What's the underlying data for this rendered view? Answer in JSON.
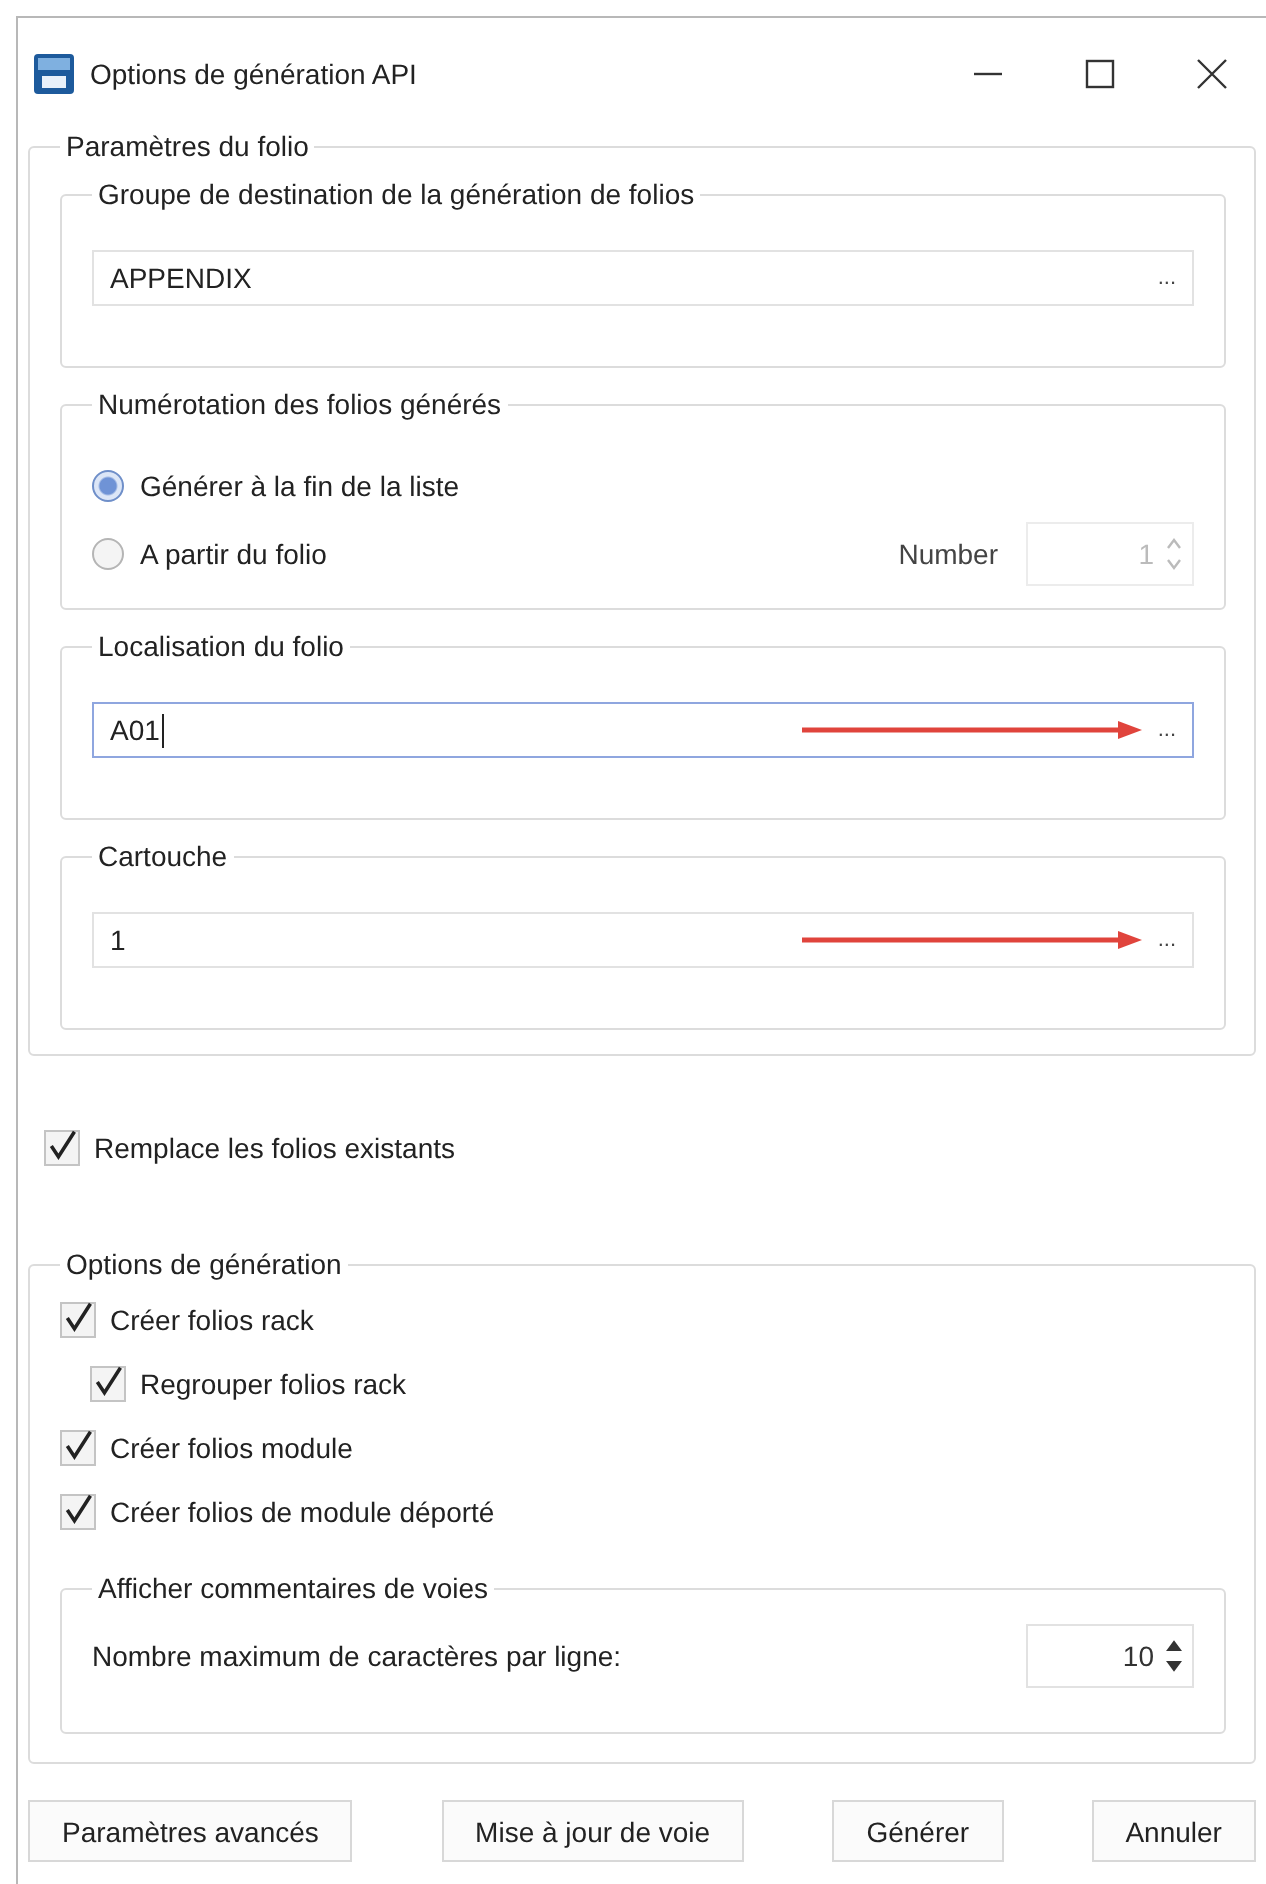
{
  "window": {
    "title": "Options de génération API"
  },
  "folio_parameters": {
    "title": "Paramètres du folio",
    "destination_group": {
      "title": "Groupe de destination de la génération de folios",
      "value": "APPENDIX",
      "browse": "...",
      "annotated": false,
      "focused": false
    },
    "numbering": {
      "title": "Numérotation des folios générés",
      "options": [
        {
          "label": "Générer à la fin de la liste",
          "selected": true
        },
        {
          "label": "A partir du folio",
          "selected": false
        }
      ],
      "number_label": "Number",
      "number_value": "1",
      "number_disabled": true
    },
    "location": {
      "title": "Localisation du folio",
      "value": "A01",
      "browse": "...",
      "annotated": true,
      "focused": true
    },
    "title_block": {
      "title": "Cartouche",
      "value": "1",
      "browse": "...",
      "annotated": true,
      "focused": false
    }
  },
  "replace_existing": {
    "label": "Remplace les folios existants",
    "checked": true
  },
  "generation_options": {
    "title": "Options de génération",
    "checks": [
      {
        "label": "Créer folios rack",
        "checked": true,
        "children": [
          {
            "label": "Regrouper folios rack",
            "checked": true
          }
        ]
      },
      {
        "label": "Créer folios module",
        "checked": true
      },
      {
        "label": "Créer folios de module déporté",
        "checked": true
      }
    ],
    "comments": {
      "title": "Afficher commentaires de voies",
      "label": "Nombre maximum de caractères par ligne:",
      "value": "10"
    }
  },
  "buttons": [
    "Paramètres avancés",
    "Mise à jour de voie",
    "Générer",
    "Annuler"
  ]
}
